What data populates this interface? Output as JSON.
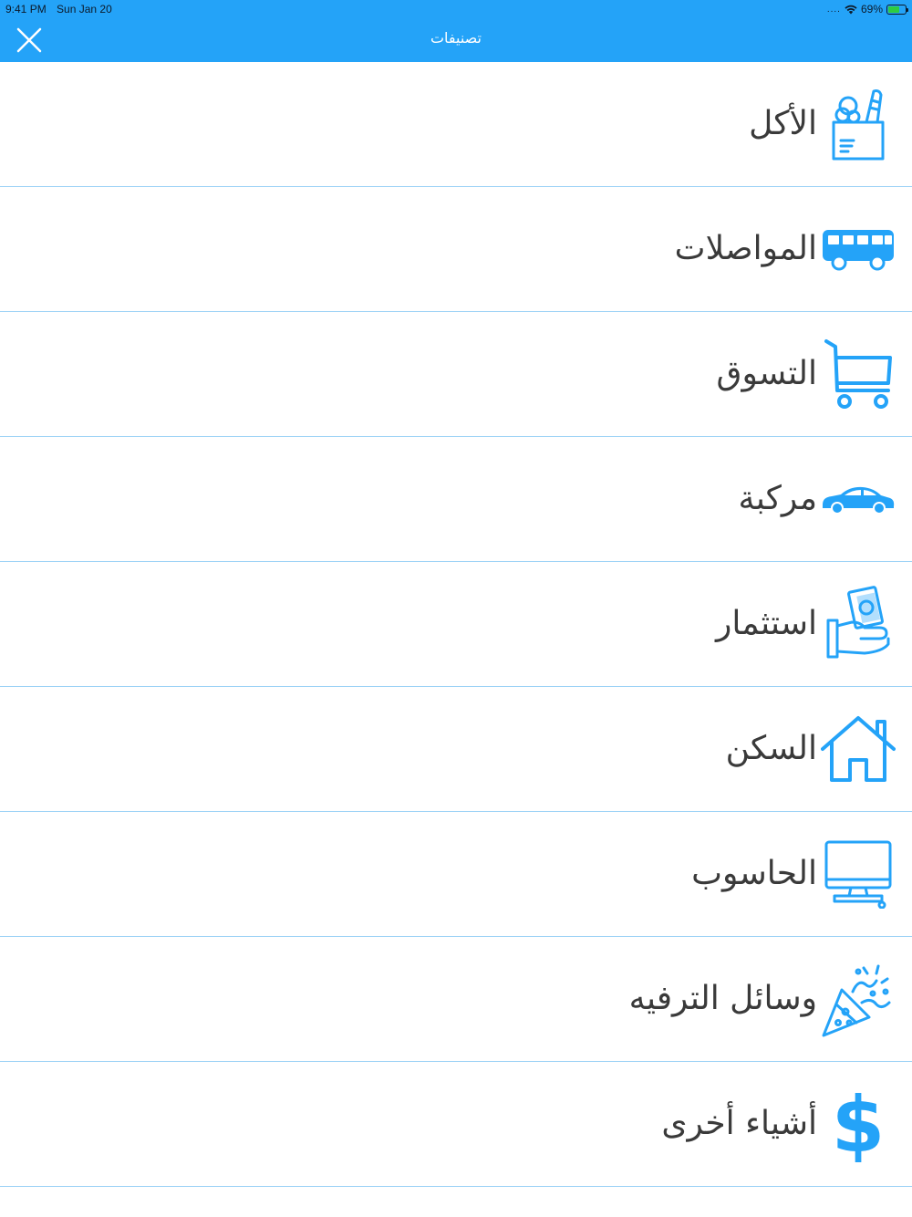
{
  "status_bar": {
    "time": "9:41 PM",
    "date": "Sun Jan 20",
    "signal": "....",
    "battery_percent": "69%",
    "battery_level": 0.69
  },
  "header": {
    "title": "تصنيفات",
    "close_icon": "close-icon",
    "accent_color": "#24a3f8"
  },
  "categories": [
    {
      "label": "الأكل",
      "icon": "grocery-bag-icon"
    },
    {
      "label": "المواصلات",
      "icon": "bus-icon"
    },
    {
      "label": "التسوق",
      "icon": "shopping-cart-icon"
    },
    {
      "label": "مركبة",
      "icon": "car-icon"
    },
    {
      "label": "استثمار",
      "icon": "money-hand-icon"
    },
    {
      "label": "السكن",
      "icon": "house-icon"
    },
    {
      "label": "الحاسوب",
      "icon": "computer-icon"
    },
    {
      "label": "وسائل الترفيه",
      "icon": "party-popper-icon"
    },
    {
      "label": "أشياء أخرى",
      "icon": "dollar-icon"
    }
  ]
}
